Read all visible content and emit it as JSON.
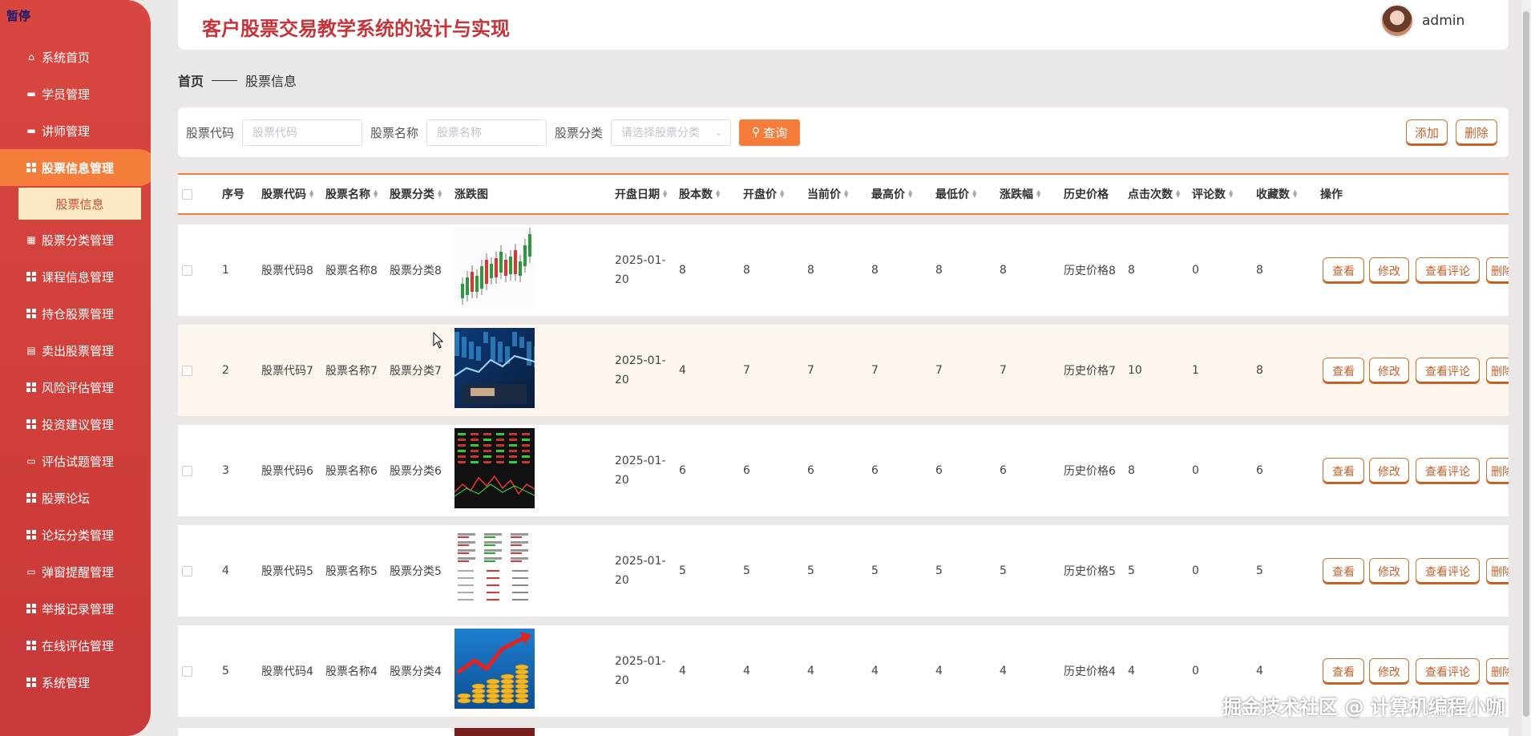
{
  "sidebar": {
    "pause_label": "暂停",
    "items": [
      {
        "label": "系统首页",
        "icon": "home-icon"
      },
      {
        "label": "学员管理",
        "icon": "user-icon"
      },
      {
        "label": "讲师管理",
        "icon": "book-icon"
      },
      {
        "label": "股票信息管理",
        "icon": "grid-icon",
        "active": true
      },
      {
        "label": "股票分类管理",
        "icon": "chart-icon"
      },
      {
        "label": "课程信息管理",
        "icon": "grid-icon"
      },
      {
        "label": "持仓股票管理",
        "icon": "grid-icon"
      },
      {
        "label": "卖出股票管理",
        "icon": "doc-icon"
      },
      {
        "label": "风险评估管理",
        "icon": "grid-icon"
      },
      {
        "label": "投资建议管理",
        "icon": "grid-icon"
      },
      {
        "label": "评估试题管理",
        "icon": "chat-icon"
      },
      {
        "label": "股票论坛",
        "icon": "grid-icon"
      },
      {
        "label": "论坛分类管理",
        "icon": "grid-icon"
      },
      {
        "label": "弹窗提醒管理",
        "icon": "monitor-icon"
      },
      {
        "label": "举报记录管理",
        "icon": "grid-icon"
      },
      {
        "label": "在线评估管理",
        "icon": "grid-icon"
      },
      {
        "label": "系统管理",
        "icon": "grid-icon"
      }
    ],
    "sub_item": "股票信息"
  },
  "header": {
    "title": "客户股票交易教学系统的设计与实现",
    "username": "admin"
  },
  "breadcrumb": {
    "home": "首页",
    "current": "股票信息"
  },
  "search": {
    "code_label": "股票代码",
    "code_placeholder": "股票代码",
    "name_label": "股票名称",
    "name_placeholder": "股票名称",
    "category_label": "股票分类",
    "category_placeholder": "请选择股票分类",
    "query_button": "查询",
    "add_button": "添加",
    "delete_button": "删除"
  },
  "table": {
    "headers": {
      "index": "序号",
      "code": "股票代码",
      "name": "股票名称",
      "category": "股票分类",
      "chart": "涨跌图",
      "open_date": "开盘日期",
      "shares": "股本数",
      "open_price": "开盘价",
      "current_price": "当前价",
      "high": "最高价",
      "low": "最低价",
      "change": "涨跌幅",
      "history": "历史价格",
      "clicks": "点击次数",
      "comments": "评论数",
      "favorites": "收藏数",
      "actions": "操作"
    },
    "actions": {
      "view": "查看",
      "edit": "修改",
      "view_comments": "查看评论",
      "delete": "删除"
    },
    "rows": [
      {
        "index": "1",
        "code": "股票代码8",
        "name": "股票名称8",
        "category": "股票分类8",
        "open_date": "2025-01-20",
        "shares": "8",
        "open_price": "8",
        "current_price": "8",
        "high": "8",
        "low": "8",
        "change": "8",
        "history": "历史价格8",
        "clicks": "8",
        "comments": "0",
        "favorites": "8",
        "thumb": "candlestick"
      },
      {
        "index": "2",
        "code": "股票代码7",
        "name": "股票名称7",
        "category": "股票分类7",
        "open_date": "2025-01-20",
        "shares": "4",
        "open_price": "7",
        "current_price": "7",
        "high": "7",
        "low": "7",
        "change": "7",
        "history": "历史价格7",
        "clicks": "10",
        "comments": "1",
        "favorites": "8",
        "thumb": "blue-screen"
      },
      {
        "index": "3",
        "code": "股票代码6",
        "name": "股票名称6",
        "category": "股票分类6",
        "open_date": "2025-01-20",
        "shares": "6",
        "open_price": "6",
        "current_price": "6",
        "high": "6",
        "low": "6",
        "change": "6",
        "history": "历史价格6",
        "clicks": "8",
        "comments": "0",
        "favorites": "6",
        "thumb": "dark-ticker"
      },
      {
        "index": "4",
        "code": "股票代码5",
        "name": "股票名称5",
        "category": "股票分类5",
        "open_date": "2025-01-20",
        "shares": "5",
        "open_price": "5",
        "current_price": "5",
        "high": "5",
        "low": "5",
        "change": "5",
        "history": "历史价格5",
        "clicks": "5",
        "comments": "0",
        "favorites": "5",
        "thumb": "app-screen"
      },
      {
        "index": "5",
        "code": "股票代码4",
        "name": "股票名称4",
        "category": "股票分类4",
        "open_date": "2025-01-20",
        "shares": "4",
        "open_price": "4",
        "current_price": "4",
        "high": "4",
        "low": "4",
        "change": "4",
        "history": "历史价格4",
        "clicks": "4",
        "comments": "0",
        "favorites": "4",
        "thumb": "coins-arrow"
      }
    ]
  },
  "watermark": "掘金技术社区 @ 计算机编程小咖",
  "colors": {
    "primary": "#f47d3b",
    "sidebar": "#d0403b",
    "title": "#c6343a"
  }
}
